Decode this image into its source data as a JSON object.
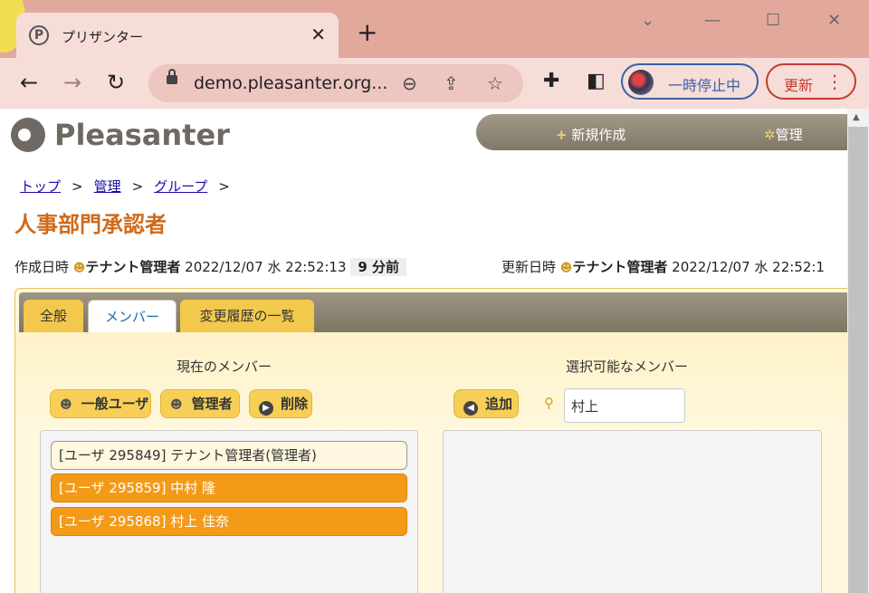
{
  "browser": {
    "tab_title": "プリザンター",
    "favicon_letter": "P",
    "tab_close": "✕",
    "new_tab": "+",
    "url": "demo.pleasanter.org...",
    "profile_label": "一時停止中",
    "update_label": "更新"
  },
  "site": {
    "logo_text": "Pleasanter",
    "nav": {
      "new_label": "新規作成",
      "admin_label": "管理"
    }
  },
  "breadcrumb": [
    "トップ",
    "管理",
    "グループ"
  ],
  "breadcrumb_sep": ">",
  "title": "人事部門承認者",
  "meta": {
    "created_label": "作成日時",
    "created_user": "テナント管理者",
    "created_at": "2022/12/07 水 22:52:13",
    "created_ago": "9 分前",
    "updated_label": "更新日時",
    "updated_user": "テナント管理者",
    "updated_at": "2022/12/07 水 22:52:1"
  },
  "tabs": [
    "全般",
    "メンバー",
    "変更履歴の一覧"
  ],
  "active_tab": "メンバー",
  "members": {
    "current_title": "現在のメンバー",
    "available_title": "選択可能なメンバー",
    "buttons": {
      "general_user": "一般ユーザ",
      "admin": "管理者",
      "delete": "削除",
      "add": "追加"
    },
    "search_value": "村上",
    "current_list": [
      {
        "label": "[ユーザ 295849] テナント管理者(管理者)",
        "selected": false
      },
      {
        "label": "[ユーザ 295859] 中村 隆",
        "selected": true
      },
      {
        "label": "[ユーザ 295868] 村上 佳奈",
        "selected": true
      }
    ],
    "available_list": []
  },
  "colors": {
    "accent": "#f39a18",
    "title": "#d06a1a",
    "button": "#f7cf57",
    "chrome": "#e3a89c"
  }
}
